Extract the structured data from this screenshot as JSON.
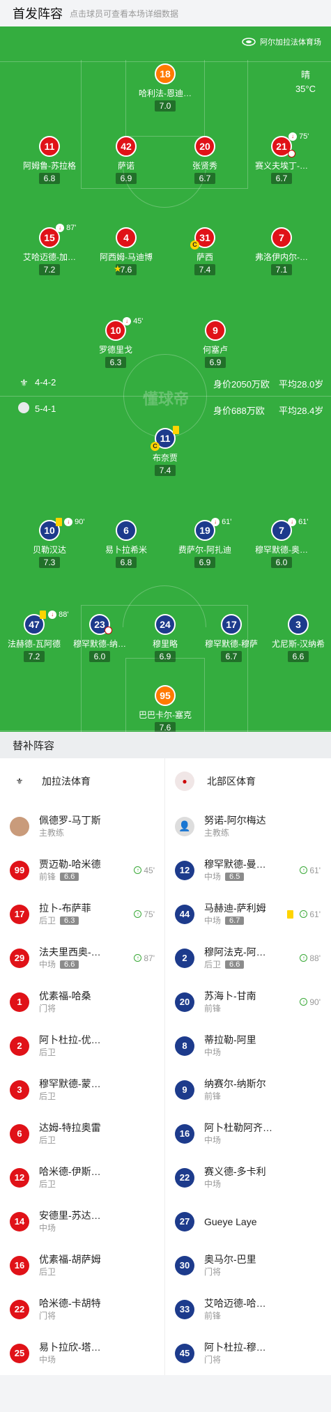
{
  "header": {
    "title": "首发阵容",
    "subtitle": "点击球员可查看本场详细数据"
  },
  "venue": "阿尔加拉法体育场",
  "weather": {
    "condition": "晴",
    "temp": "35°C"
  },
  "watermark": "懂球帝",
  "home_info": {
    "formation": "4-4-2",
    "value": "身价2050万欧",
    "age": "平均28.0岁"
  },
  "away_info": {
    "formation": "5-4-1",
    "value": "身价688万欧",
    "age": "平均28.4岁"
  },
  "home_players": [
    {
      "num": "18",
      "name": "哈利法-恩迪…",
      "rating": "7.0"
    },
    {
      "num": "11",
      "name": "阿姆鲁-苏拉格",
      "rating": "6.8"
    },
    {
      "num": "42",
      "name": "萨诺",
      "rating": "6.9"
    },
    {
      "num": "20",
      "name": "张贤秀",
      "rating": "6.7"
    },
    {
      "num": "21",
      "name": "赛义夫埃丁-…",
      "rating": "6.7",
      "event": "75'"
    },
    {
      "num": "15",
      "name": "艾哈迈德-加…",
      "rating": "7.2",
      "event": "87'"
    },
    {
      "num": "4",
      "name": "阿西姆-马迪博",
      "rating": "7.6"
    },
    {
      "num": "31",
      "name": "萨西",
      "rating": "7.4"
    },
    {
      "num": "7",
      "name": "弗洛伊内尔-…",
      "rating": "7.1"
    },
    {
      "num": "10",
      "name": "罗德里戈",
      "rating": "6.3",
      "event": "45'"
    },
    {
      "num": "9",
      "name": "何塞卢",
      "rating": "6.9"
    }
  ],
  "away_players": [
    {
      "num": "11",
      "name": "布奈贾",
      "rating": "7.4"
    },
    {
      "num": "10",
      "name": "贝勒汉达",
      "rating": "7.3",
      "event": "90'"
    },
    {
      "num": "6",
      "name": "易卜拉希米",
      "rating": "6.8"
    },
    {
      "num": "19",
      "name": "费萨尔-阿扎迪",
      "rating": "6.9",
      "event": "61'"
    },
    {
      "num": "7",
      "name": "穆罕默德-奥…",
      "rating": "6.0",
      "event": "61'"
    },
    {
      "num": "47",
      "name": "法赫德-瓦阿德",
      "rating": "7.2",
      "event": "88'"
    },
    {
      "num": "23",
      "name": "穆罕默德-纳…",
      "rating": "6.0"
    },
    {
      "num": "24",
      "name": "穆里略",
      "rating": "6.9"
    },
    {
      "num": "17",
      "name": "穆罕默德-穆萨",
      "rating": "6.7"
    },
    {
      "num": "3",
      "name": "尤尼斯-汉纳希",
      "rating": "6.6"
    },
    {
      "num": "95",
      "name": "巴巴卡尔-塞克",
      "rating": "7.6"
    }
  ],
  "subs_title": "替补阵容",
  "home_team": "加拉法体育",
  "away_team": "北部区体育",
  "home_coach": {
    "name": "佩德罗-马丁斯",
    "role": "主教练"
  },
  "away_coach": {
    "name": "努诺-阿尔梅达",
    "role": "主教练"
  },
  "home_subs": [
    {
      "num": "99",
      "name": "贾迈勒-哈米德",
      "pos": "前锋",
      "rating": "6.6",
      "in": "45'"
    },
    {
      "num": "17",
      "name": "拉卜-布萨菲",
      "pos": "后卫",
      "rating": "6.3",
      "in": "75'"
    },
    {
      "num": "29",
      "name": "法夫里西奥-…",
      "pos": "中场",
      "rating": "6.6",
      "in": "87'"
    },
    {
      "num": "1",
      "name": "优素福-哈桑",
      "pos": "门将"
    },
    {
      "num": "2",
      "name": "阿卜杜拉-优…",
      "pos": "后卫"
    },
    {
      "num": "3",
      "name": "穆罕默德-蒙…",
      "pos": "后卫"
    },
    {
      "num": "6",
      "name": "达姆-特拉奥雷",
      "pos": "后卫"
    },
    {
      "num": "12",
      "name": "哈米德-伊斯…",
      "pos": "后卫"
    },
    {
      "num": "14",
      "name": "安德里-苏达…",
      "pos": "中场"
    },
    {
      "num": "16",
      "name": "优素福-胡萨姆",
      "pos": "后卫"
    },
    {
      "num": "22",
      "name": "哈米德-卡胡特",
      "pos": "门将"
    },
    {
      "num": "25",
      "name": "易卜拉欣-塔…",
      "pos": "中场"
    }
  ],
  "away_subs": [
    {
      "num": "12",
      "name": "穆罕默德-曼…",
      "pos": "中场",
      "rating": "6.5",
      "in": "61'"
    },
    {
      "num": "44",
      "name": "马赫迪-萨利姆",
      "pos": "中场",
      "rating": "6.7",
      "in": "61'"
    },
    {
      "num": "2",
      "name": "穆阿法克-阿…",
      "pos": "后卫",
      "rating": "6.6",
      "in": "88'"
    },
    {
      "num": "20",
      "name": "苏海卜-甘南",
      "pos": "前锋",
      "in": "90'"
    },
    {
      "num": "8",
      "name": "蒂拉勒-阿里",
      "pos": "中场"
    },
    {
      "num": "9",
      "name": "纳赛尔-纳斯尔",
      "pos": "前锋"
    },
    {
      "num": "16",
      "name": "阿卜杜勒阿齐…",
      "pos": "中场"
    },
    {
      "num": "22",
      "name": "赛义德-多卡利",
      "pos": "中场"
    },
    {
      "num": "27",
      "name": "Gueye Laye",
      "pos": ""
    },
    {
      "num": "30",
      "name": "奥马尔-巴里",
      "pos": "门将"
    },
    {
      "num": "33",
      "name": "艾哈迈德-哈…",
      "pos": "前锋"
    },
    {
      "num": "45",
      "name": "阿卜杜拉-穆…",
      "pos": "门将"
    }
  ]
}
